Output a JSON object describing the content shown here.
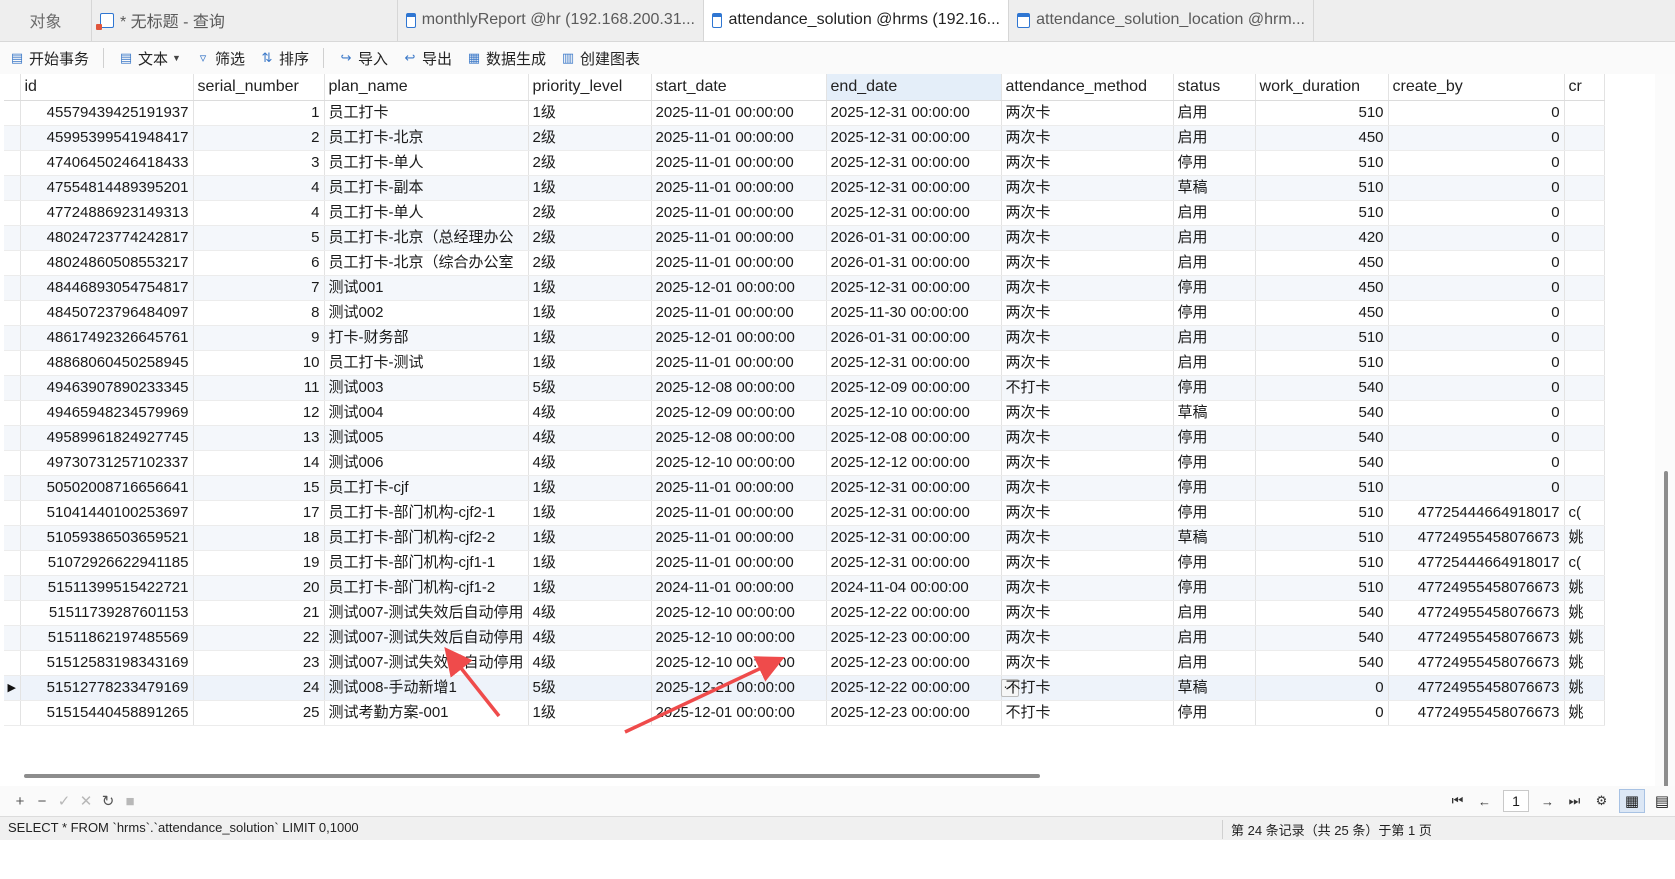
{
  "tabs": [
    {
      "label": "对象",
      "icon": "none"
    },
    {
      "label": "* 无标题 - 查询",
      "icon": "query-icon"
    },
    {
      "label": "monthlyReport @hr (192.168.200.31...",
      "icon": "table-icon"
    },
    {
      "label": "attendance_solution @hrms (192.16...",
      "icon": "table-icon"
    },
    {
      "label": "attendance_solution_location @hrm...",
      "icon": "table-icon"
    }
  ],
  "toolbar": {
    "begin_transaction": "开始事务",
    "text": "文本",
    "filter": "筛选",
    "sort": "排序",
    "import": "导入",
    "export": "导出",
    "data_generation": "数据生成",
    "create_chart": "创建图表"
  },
  "grid": {
    "columns": [
      "id",
      "serial_number",
      "plan_name",
      "priority_level",
      "start_date",
      "end_date",
      "attendance_method",
      "status",
      "work_duration",
      "create_by",
      "cr"
    ],
    "rows": [
      [
        "45579439425191937",
        "1",
        "员工打卡",
        "1级",
        "2025-11-01 00:00:00",
        "2025-12-31 00:00:00",
        "两次卡",
        "启用",
        "510",
        "0",
        ""
      ],
      [
        "45995399541948417",
        "2",
        "员工打卡-北京",
        "2级",
        "2025-11-01 00:00:00",
        "2025-12-31 00:00:00",
        "两次卡",
        "启用",
        "450",
        "0",
        ""
      ],
      [
        "47406450246418433",
        "3",
        "员工打卡-单人",
        "2级",
        "2025-11-01 00:00:00",
        "2025-12-31 00:00:00",
        "两次卡",
        "停用",
        "510",
        "0",
        ""
      ],
      [
        "47554814489395201",
        "4",
        "员工打卡-副本",
        "1级",
        "2025-11-01 00:00:00",
        "2025-12-31 00:00:00",
        "两次卡",
        "草稿",
        "510",
        "0",
        ""
      ],
      [
        "47724886923149313",
        "4",
        "员工打卡-单人",
        "2级",
        "2025-11-01 00:00:00",
        "2025-12-31 00:00:00",
        "两次卡",
        "启用",
        "510",
        "0",
        ""
      ],
      [
        "48024723774242817",
        "5",
        "员工打卡-北京（总经理办公",
        "2级",
        "2025-11-01 00:00:00",
        "2026-01-31 00:00:00",
        "两次卡",
        "启用",
        "420",
        "0",
        ""
      ],
      [
        "48024860508553217",
        "6",
        "员工打卡-北京（综合办公室",
        "2级",
        "2025-11-01 00:00:00",
        "2026-01-31 00:00:00",
        "两次卡",
        "启用",
        "450",
        "0",
        ""
      ],
      [
        "48446893054754817",
        "7",
        "测试001",
        "1级",
        "2025-12-01 00:00:00",
        "2025-12-31 00:00:00",
        "两次卡",
        "停用",
        "450",
        "0",
        ""
      ],
      [
        "48450723796484097",
        "8",
        "测试002",
        "1级",
        "2025-11-01 00:00:00",
        "2025-11-30 00:00:00",
        "两次卡",
        "停用",
        "450",
        "0",
        ""
      ],
      [
        "48617492326645761",
        "9",
        "打卡-财务部",
        "1级",
        "2025-12-01 00:00:00",
        "2026-01-31 00:00:00",
        "两次卡",
        "启用",
        "510",
        "0",
        ""
      ],
      [
        "48868060450258945",
        "10",
        "员工打卡-测试",
        "1级",
        "2025-11-01 00:00:00",
        "2025-12-31 00:00:00",
        "两次卡",
        "启用",
        "510",
        "0",
        ""
      ],
      [
        "49463907890233345",
        "11",
        "测试003",
        "5级",
        "2025-12-08 00:00:00",
        "2025-12-09 00:00:00",
        "不打卡",
        "停用",
        "540",
        "0",
        ""
      ],
      [
        "49465948234579969",
        "12",
        "测试004",
        "4级",
        "2025-12-09 00:00:00",
        "2025-12-10 00:00:00",
        "两次卡",
        "草稿",
        "540",
        "0",
        ""
      ],
      [
        "49589961824927745",
        "13",
        "测试005",
        "4级",
        "2025-12-08 00:00:00",
        "2025-12-08 00:00:00",
        "两次卡",
        "停用",
        "540",
        "0",
        ""
      ],
      [
        "49730731257102337",
        "14",
        "测试006",
        "4级",
        "2025-12-10 00:00:00",
        "2025-12-12 00:00:00",
        "两次卡",
        "停用",
        "540",
        "0",
        ""
      ],
      [
        "50502008716656641",
        "15",
        "员工打卡-cjf",
        "1级",
        "2025-11-01 00:00:00",
        "2025-12-31 00:00:00",
        "两次卡",
        "停用",
        "510",
        "0",
        ""
      ],
      [
        "51041440100253697",
        "17",
        "员工打卡-部门机构-cjf2-1",
        "1级",
        "2025-11-01 00:00:00",
        "2025-12-31 00:00:00",
        "两次卡",
        "停用",
        "510",
        "47725444664918017",
        "c("
      ],
      [
        "51059386503659521",
        "18",
        "员工打卡-部门机构-cjf2-2",
        "1级",
        "2025-11-01 00:00:00",
        "2025-12-31 00:00:00",
        "两次卡",
        "草稿",
        "510",
        "47724955458076673",
        "姚"
      ],
      [
        "51072926622941185",
        "19",
        "员工打卡-部门机构-cjf1-1",
        "1级",
        "2025-11-01 00:00:00",
        "2025-12-31 00:00:00",
        "两次卡",
        "停用",
        "510",
        "47725444664918017",
        "c("
      ],
      [
        "51511399515422721",
        "20",
        "员工打卡-部门机构-cjf1-2",
        "1级",
        "2024-11-01 00:00:00",
        "2024-11-04 00:00:00",
        "两次卡",
        "停用",
        "510",
        "47724955458076673",
        "姚"
      ],
      [
        "51511739287601153",
        "21",
        "测试007-测试失效后自动停用",
        "4级",
        "2025-12-10 00:00:00",
        "2025-12-22 00:00:00",
        "两次卡",
        "启用",
        "540",
        "47724955458076673",
        "姚"
      ],
      [
        "51511862197485569",
        "22",
        "测试007-测试失效后自动停用",
        "4级",
        "2025-12-10 00:00:00",
        "2025-12-23 00:00:00",
        "两次卡",
        "启用",
        "540",
        "47724955458076673",
        "姚"
      ],
      [
        "51512583198343169",
        "23",
        "测试007-测试失效后自动停用",
        "4级",
        "2025-12-10 00:00:00",
        "2025-12-23 00:00:00",
        "两次卡",
        "启用",
        "540",
        "47724955458076673",
        "姚"
      ],
      [
        "51512778233479169",
        "24",
        "测试008-手动新增1",
        "5级",
        "2025-12-21 00:00:00",
        "2025-12-22 00:00:00",
        "不打卡",
        "草稿",
        "0",
        "47724955458076673",
        "姚"
      ],
      [
        "51515440458891265",
        "25",
        "测试考勤方案-001",
        "1级",
        "2025-12-01 00:00:00",
        "2025-12-23 00:00:00",
        "不打卡",
        "停用",
        "0",
        "47724955458076673",
        "姚"
      ]
    ],
    "current_row_index": 23,
    "selected_column": "end_date"
  },
  "bottom": {
    "page_number": "1"
  },
  "status": {
    "sql": "SELECT * FROM `hrms`.`attendance_solution` LIMIT 0,1000",
    "records": "第 24 条记录（共 25 条）于第 1 页"
  },
  "colors": {
    "selection": "#0a58c8",
    "annotation_arrow": "#ef4b4b",
    "accent": "#2f76d2"
  }
}
